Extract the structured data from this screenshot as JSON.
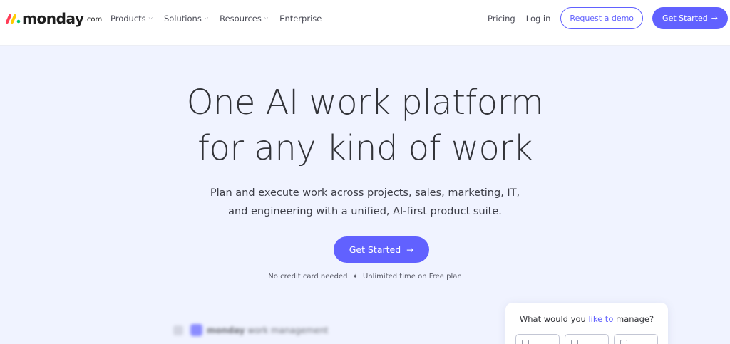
{
  "header": {
    "logo": {
      "word": "monday",
      "suffix": ".com",
      "mark_colors": [
        "#ff3d57",
        "#ffcb00",
        "#00ca72"
      ]
    },
    "nav": [
      {
        "label": "Products",
        "has_dropdown": true,
        "icon": "chevron-down-icon"
      },
      {
        "label": "Solutions",
        "has_dropdown": true,
        "icon": "chevron-down-icon"
      },
      {
        "label": "Resources",
        "has_dropdown": true,
        "icon": "chevron-down-icon"
      },
      {
        "label": "Enterprise",
        "has_dropdown": false
      }
    ],
    "pricing_label": "Pricing",
    "login_label": "Log in",
    "demo_label": "Request a demo",
    "get_started_label": "Get Started",
    "arrow_icon": "arrow-right-icon"
  },
  "hero": {
    "title_lines": [
      "One AI work platform",
      "for any kind of work"
    ],
    "subtitle_lines": [
      "Plan and execute work across projects, sales, marketing, IT,",
      "and engineering with a unified, AI-first product suite."
    ],
    "cta_label": "Get Started",
    "note_left": "No credit card needed",
    "note_right": "Unlimited time on Free plan",
    "note_separator_icon": "sparkle-icon"
  },
  "preview": {
    "brand": "monday",
    "product": "work management"
  },
  "manage_card": {
    "question_before": "What would you ",
    "question_highlight": "like to",
    "question_after": " manage?"
  },
  "colors": {
    "accent": "#6161ff",
    "page_background": "#f0f3ff",
    "header_background": "#ffffff",
    "text": "#323338"
  }
}
